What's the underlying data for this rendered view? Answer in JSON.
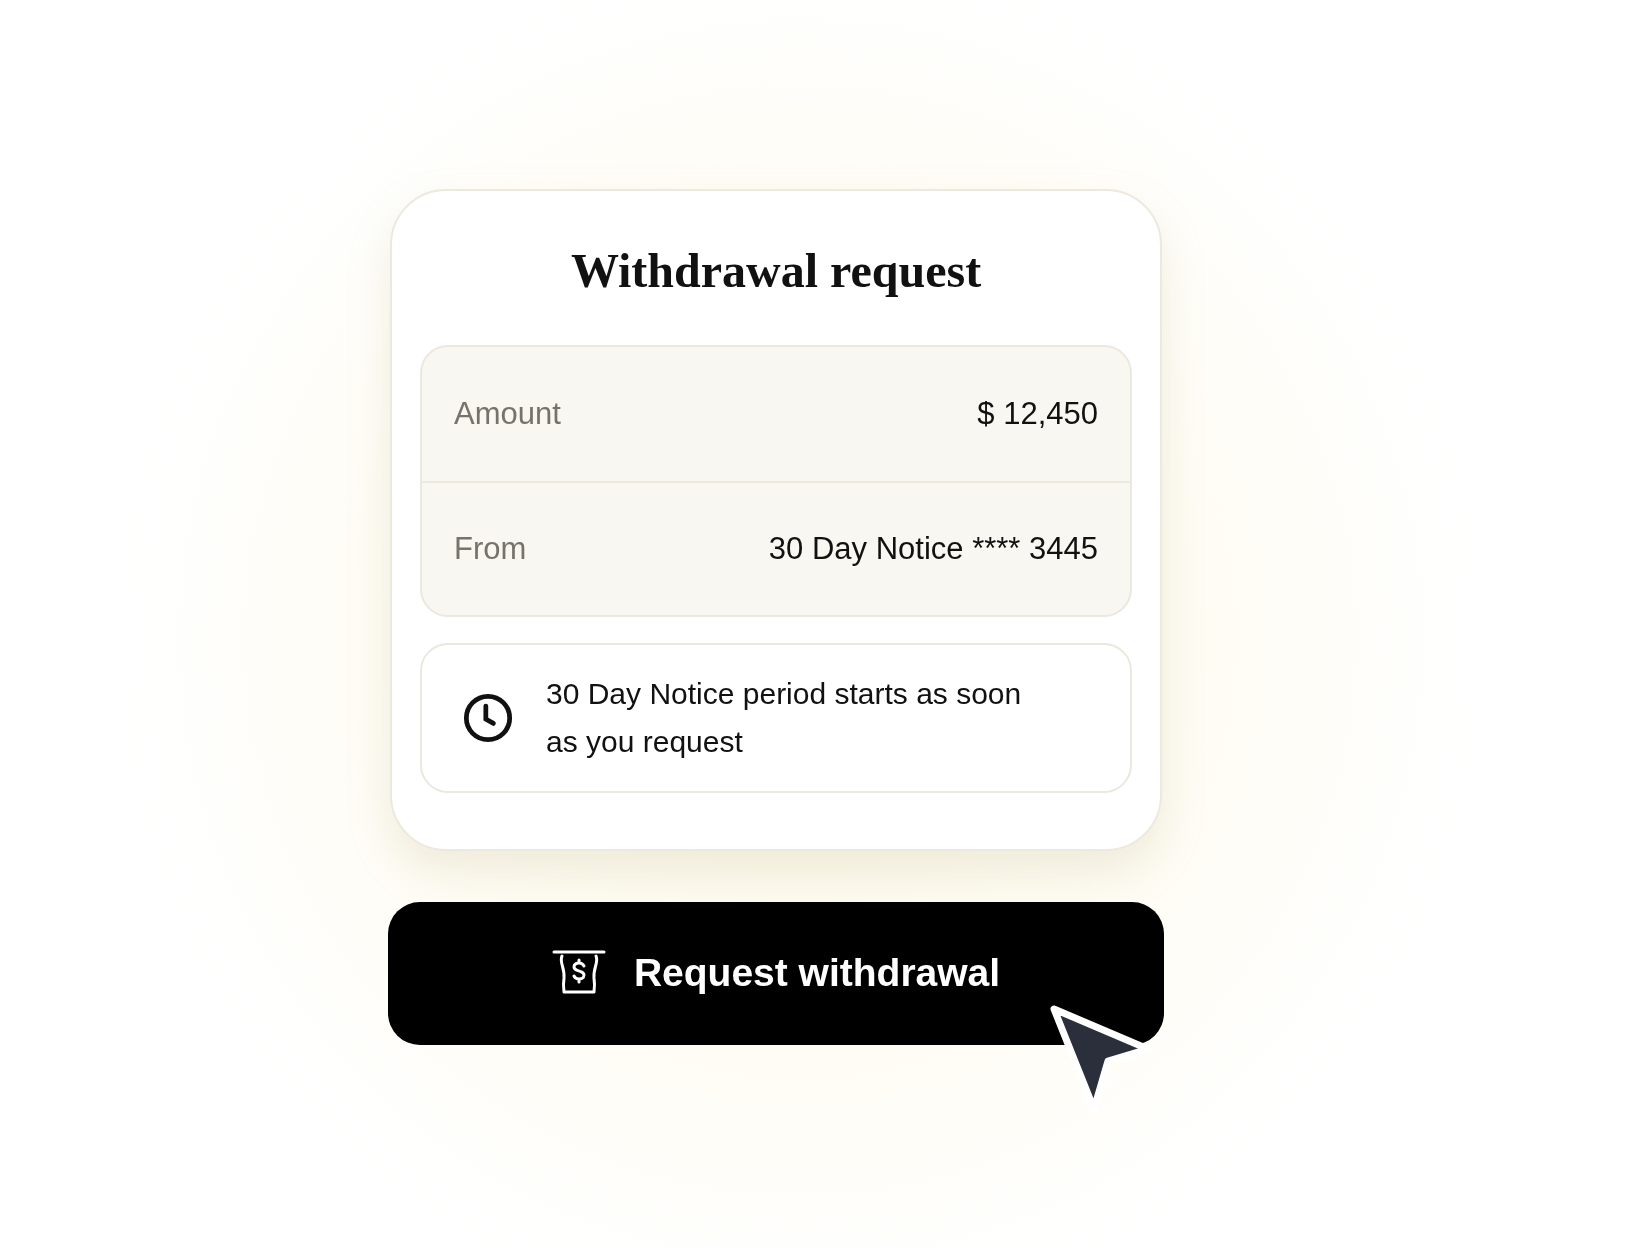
{
  "card": {
    "title": "Withdrawal request",
    "details": [
      {
        "label": "Amount",
        "value": "$ 12,450"
      },
      {
        "label": "From",
        "value": "30 Day Notice **** 3445"
      }
    ],
    "notice": "30 Day Notice period starts as soon as you request"
  },
  "button": {
    "label": "Request withdrawal"
  }
}
